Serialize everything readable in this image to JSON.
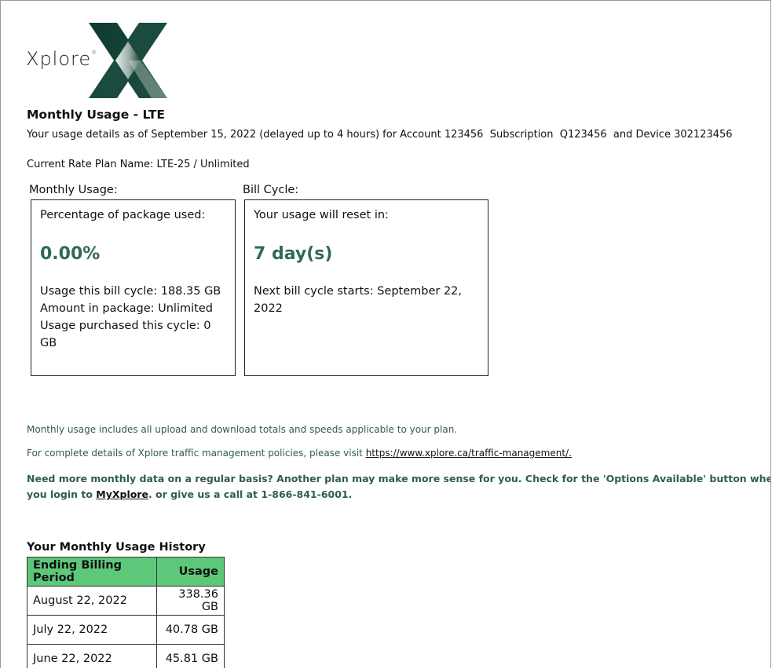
{
  "brand": {
    "name": "Xplore",
    "registered": "®"
  },
  "header": {
    "title": "Monthly Usage - LTE",
    "details_prefix": "Your usage details as of September 15, 2022 (delayed up to 4 hours) for Account",
    "account": "123456",
    "subscription_label": "Subscription",
    "subscription": "Q123456",
    "device_label": "and Device",
    "device": "302123456",
    "rate_plan": "Current Rate Plan Name: LTE-25 / Unlimited"
  },
  "monthly_usage": {
    "label": "Monthly Usage:",
    "percent_label": "Percentage of package used:",
    "percent_value": "0.00%",
    "usage_cycle": "Usage this bill cycle: 188.35 GB",
    "amount_package": "Amount in package: Unlimited",
    "usage_purchased": "Usage purchased this cycle: 0 GB"
  },
  "bill_cycle": {
    "label": "Bill Cycle:",
    "reset_label": "Your usage will reset in:",
    "reset_value": "7 day(s)",
    "next_cycle": "Next bill cycle starts: September 22, 2022"
  },
  "notes": {
    "line1": "Monthly usage includes all upload and download totals and speeds applicable to your plan.",
    "line2_prefix": "For complete details of Xplore traffic management policies, please visit",
    "line2_link": "https://www.xplore.ca/traffic-management/.",
    "promo_text": "Need more monthly data on a regular basis? Another plan may make more sense for you. Check for the 'Options Available' button when you login to",
    "promo_link": "MyXplore",
    "promo_suffix": ". or give us a call at 1-866-841-6001."
  },
  "history": {
    "title": "Your Monthly Usage History",
    "columns": [
      "Ending Billing Period",
      "Usage"
    ],
    "rows": [
      [
        "August 22, 2022",
        "338.36 GB"
      ],
      [
        "July 22, 2022",
        "40.78 GB"
      ],
      [
        "June 22, 2022",
        "45.81 GB"
      ]
    ]
  },
  "colors": {
    "accent_green": "#2f6b52",
    "table_header": "#5ec87a"
  }
}
